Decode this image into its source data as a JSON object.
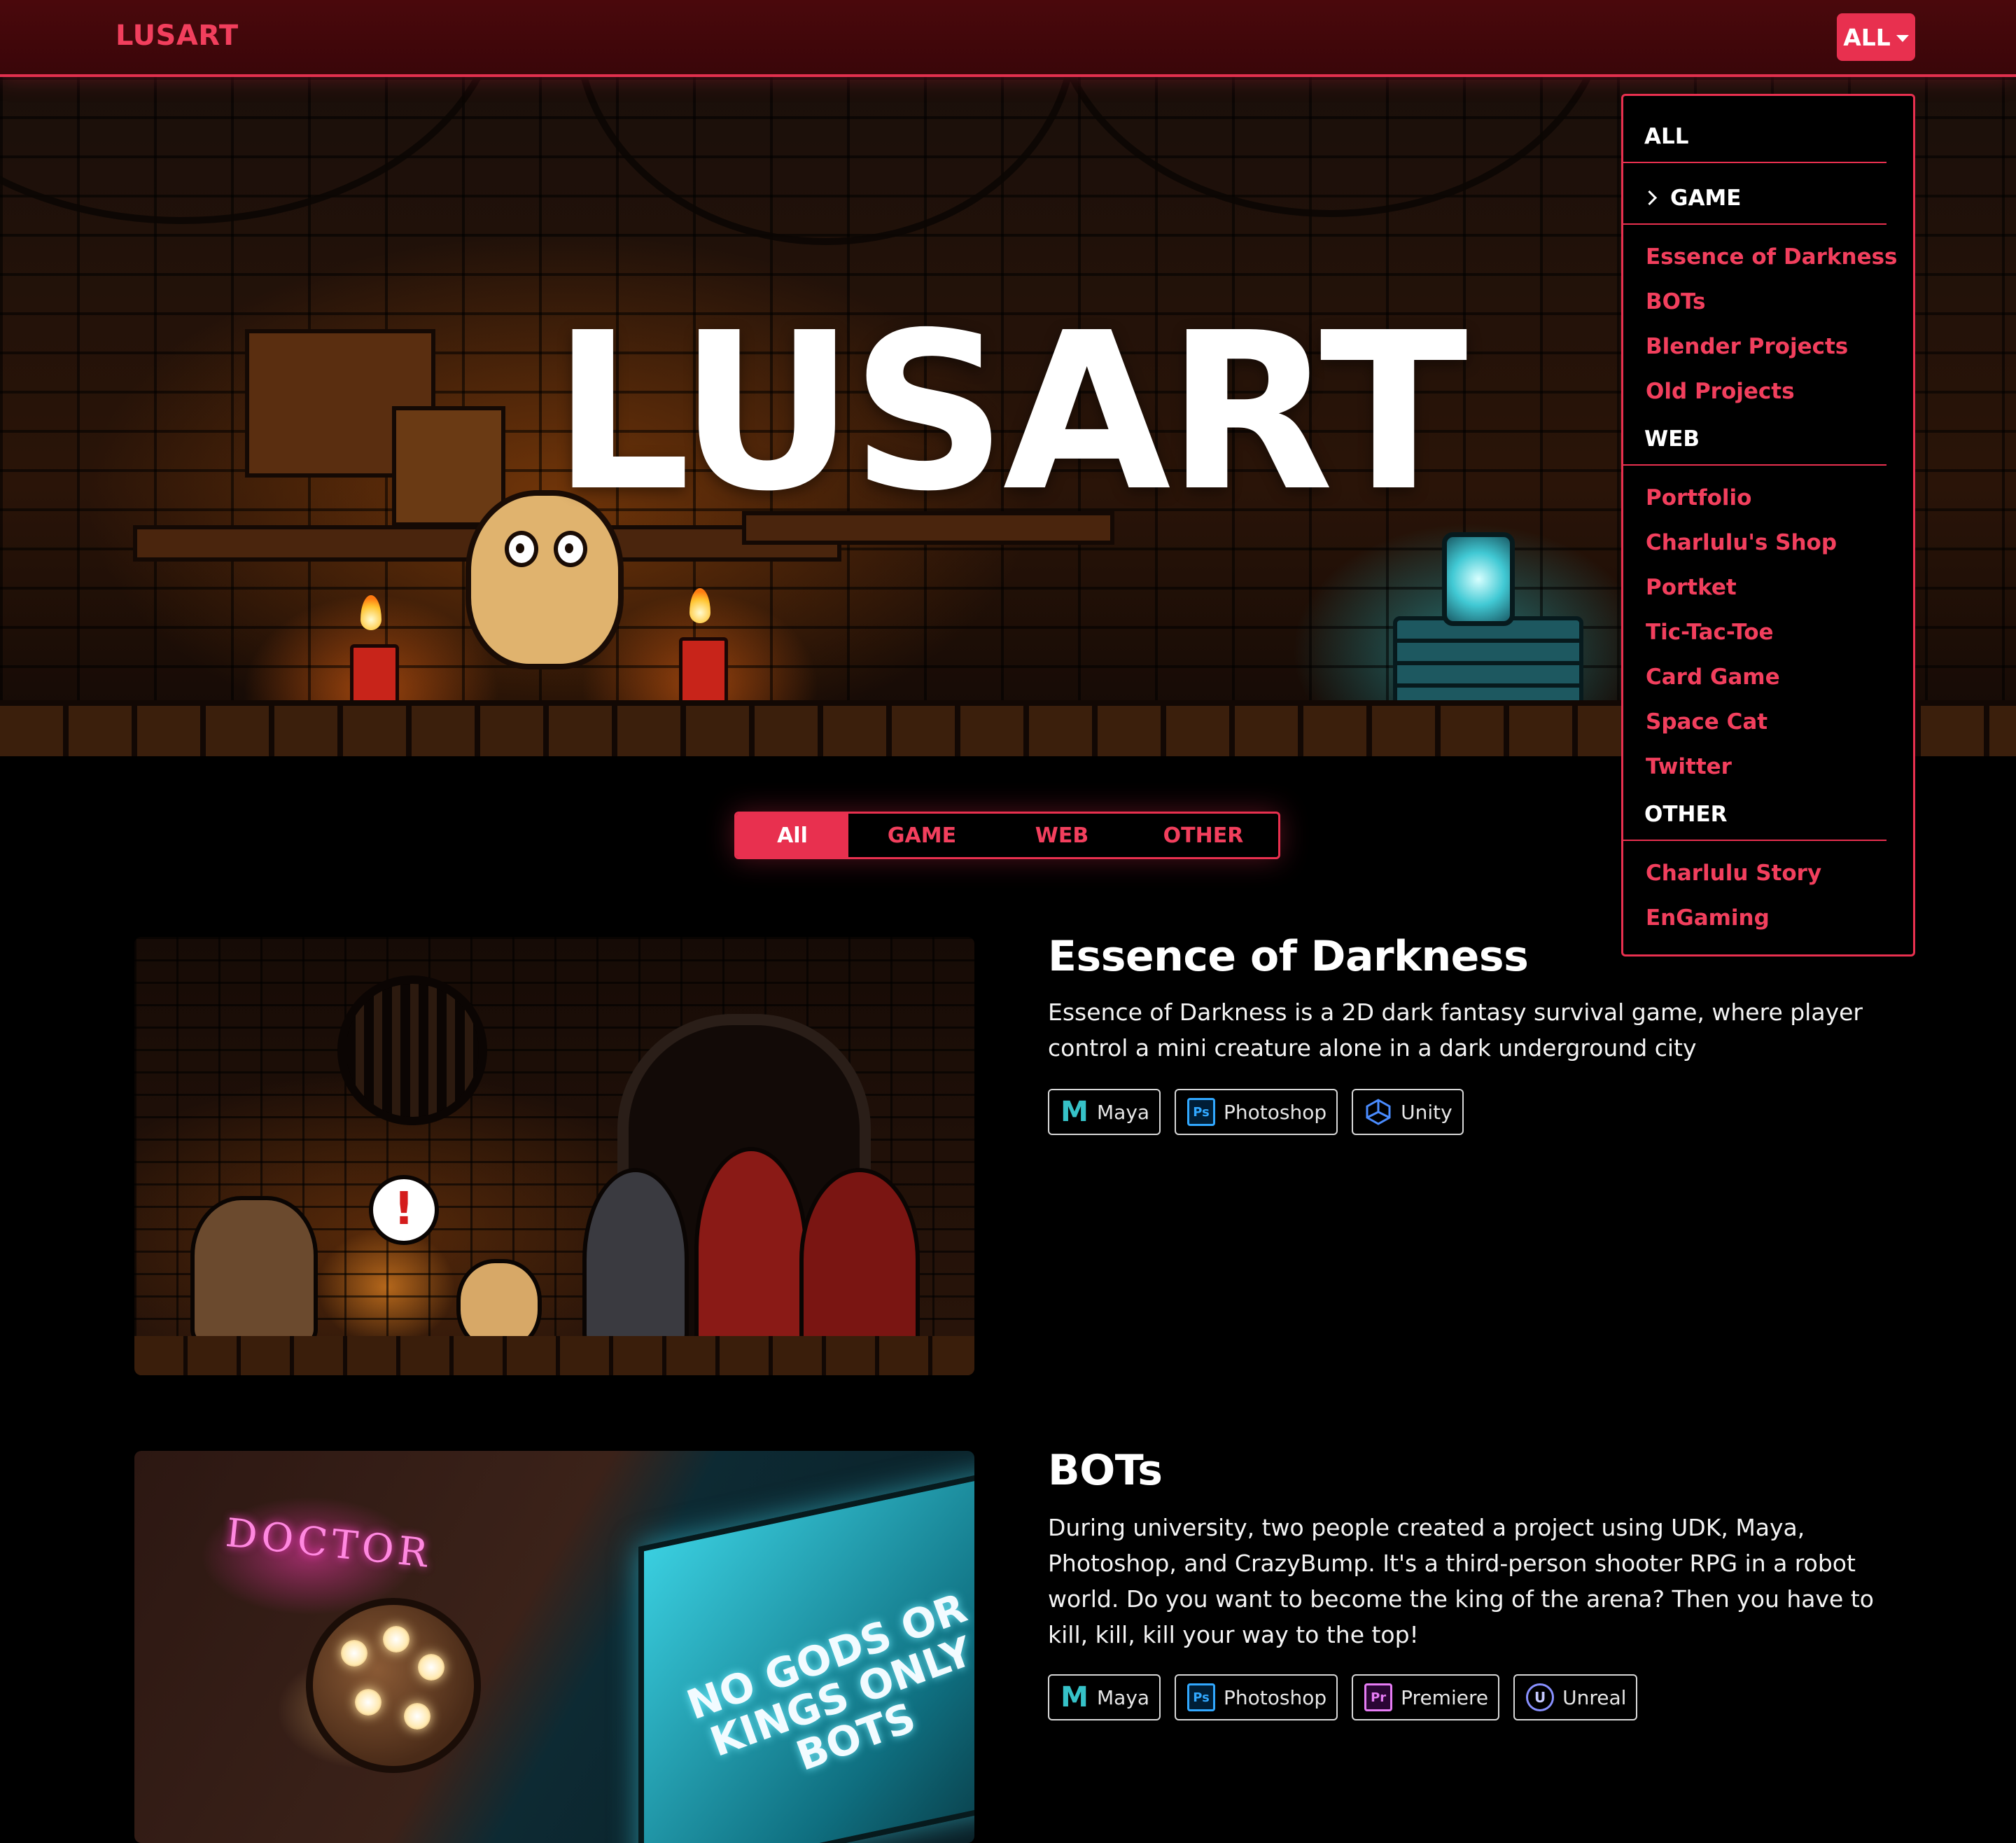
{
  "nav": {
    "brand": "LUSART",
    "filter_button": "ALL"
  },
  "hero": {
    "title": "LUSART"
  },
  "filter_tabs": [
    {
      "label": "All",
      "active": true
    },
    {
      "label": "GAME",
      "active": false
    },
    {
      "label": "WEB",
      "active": false
    },
    {
      "label": "OTHER",
      "active": false
    }
  ],
  "dropdown": {
    "all": "ALL",
    "game": {
      "label": "GAME",
      "items": [
        "Essence of Darkness",
        "BOTs",
        "Blender Projects",
        "Old Projects"
      ]
    },
    "web": {
      "label": "WEB",
      "items": [
        "Portfolio",
        "Charlulu's Shop",
        "Portket",
        "Tic-Tac-Toe",
        "Card Game",
        "Space Cat",
        "Twitter"
      ]
    },
    "other": {
      "label": "OTHER",
      "items": [
        "Charlulu Story",
        "EnGaming"
      ]
    }
  },
  "projects": [
    {
      "title": "Essence of Darkness",
      "description": "Essence of Darkness is a 2D dark fantasy survival game, where player control a mini creature alone in a dark underground city",
      "tags": [
        {
          "label": "Maya",
          "icon": "maya-icon"
        },
        {
          "label": "Photoshop",
          "icon": "photoshop-icon",
          "icon_text": "Ps"
        },
        {
          "label": "Unity",
          "icon": "unity-icon"
        }
      ]
    },
    {
      "title": "BOTs",
      "description": "During university, two people created a project using UDK, Maya, Photoshop, and CrazyBump. It's a third-person shooter RPG in a robot world. Do you want to become the king of the arena? Then you have to kill, kill, kill your way to the top!",
      "image_text": {
        "neon": "DOCTOR",
        "sign": "NO GODS OR KINGS ONLY BOTS"
      },
      "tags": [
        {
          "label": "Maya",
          "icon": "maya-icon"
        },
        {
          "label": "Photoshop",
          "icon": "photoshop-icon",
          "icon_text": "Ps"
        },
        {
          "label": "Premiere",
          "icon": "premiere-icon",
          "icon_text": "Pr"
        },
        {
          "label": "Unreal",
          "icon": "unreal-icon"
        }
      ]
    }
  ],
  "colors": {
    "accent": "#e8304f",
    "accent_text": "#f23f5d",
    "nav_bg": "#4a080c",
    "page_bg": "#000000"
  }
}
